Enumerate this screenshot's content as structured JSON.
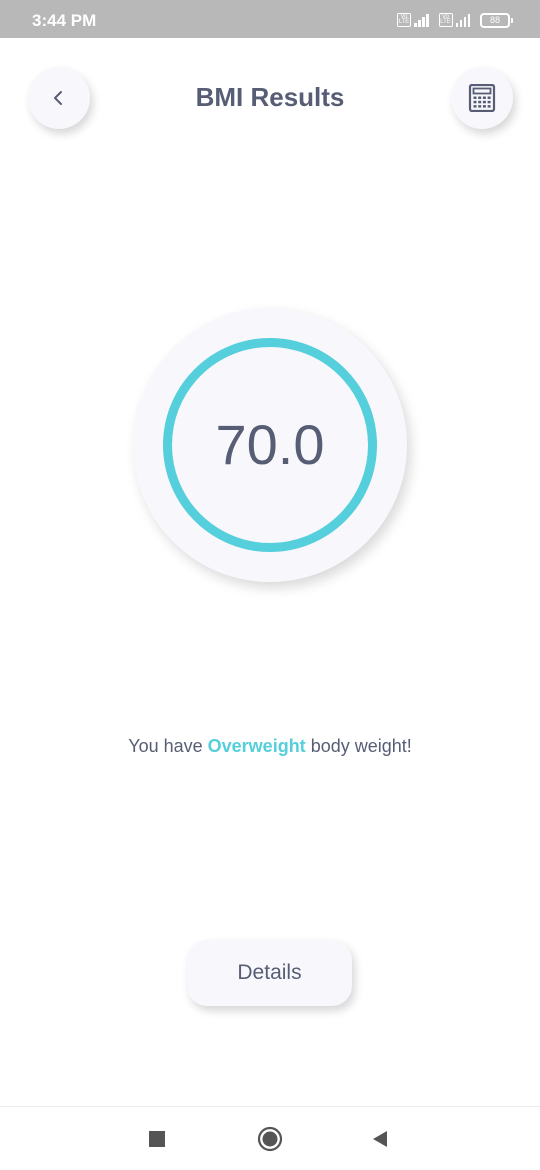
{
  "status_bar": {
    "time": "3:44 PM",
    "sim1_label": "Vo LTE",
    "sim2_label": "Vo LTE",
    "battery": "88"
  },
  "header": {
    "title": "BMI Results",
    "back_icon": "chevron-left-icon",
    "calculator_icon": "calculator-icon"
  },
  "result": {
    "bmi_value": "70.0",
    "ring_color": "#55cfdb"
  },
  "message": {
    "prefix": "You have ",
    "category": "Overweight",
    "suffix": " body weight!"
  },
  "details_button": {
    "label": "Details"
  },
  "nav_bar": {
    "recents_icon": "square-icon",
    "home_icon": "circle-icon",
    "back_icon": "triangle-back-icon"
  },
  "colors": {
    "accent": "#55cfdb",
    "text": "#575d75",
    "surface": "#f8f7fc",
    "status_bar": "#b8b8b8"
  }
}
